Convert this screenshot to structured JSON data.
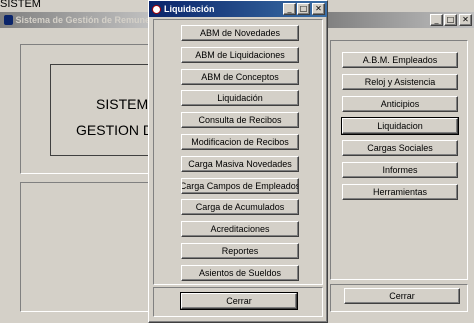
{
  "bg_window": {
    "top_text": "SISTEM",
    "title": "Sistema de Gestión de Remune",
    "heading_line1": "SISTEMA",
    "heading_line2": "GESTION DE"
  },
  "right_window": {
    "buttons": [
      "A.B.M. Empleados",
      "Reloj y Asistencia",
      "Anticipios",
      "Liquidacion",
      "Cargas Sociales",
      "Informes",
      "Herramientas"
    ],
    "close_label": "Cerrar",
    "active_button": "Liquidacion"
  },
  "dialog": {
    "title": "Liquidación",
    "buttons": [
      "ABM de Novedades",
      "ABM de Liquidaciones",
      "ABM de Conceptos",
      "Liquidación",
      "Consulta de Recibos",
      "Modificacion de Recibos",
      "Carga Masiva Novedades",
      "Carga Campos de Empleados",
      "Carga de Acumulados",
      "Acreditaciones",
      "Reportes",
      "Asientos de Sueldos"
    ],
    "close_label": "Cerrar"
  },
  "colors": {
    "titlebar_active": "#0a246a",
    "titlebar_inactive": "#808080",
    "face": "#d4d0c8"
  }
}
